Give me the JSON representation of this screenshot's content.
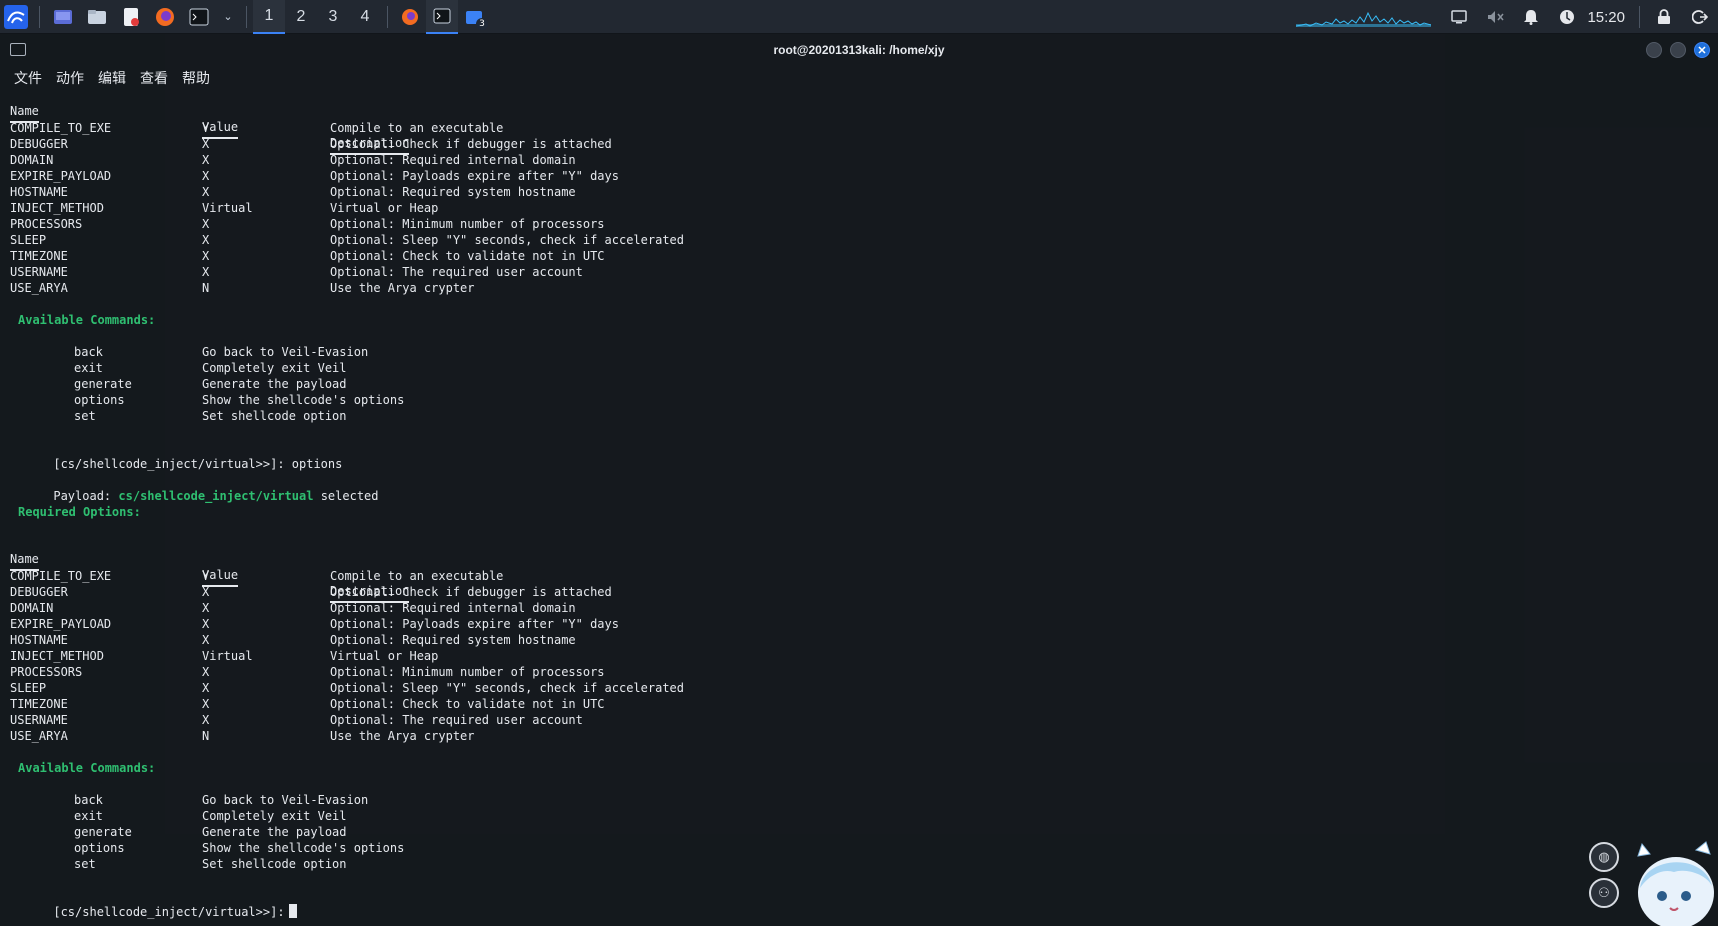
{
  "taskbar": {
    "workspaces": [
      "1",
      "2",
      "3",
      "4"
    ],
    "active_workspace": "1",
    "file_manager_badge": "3",
    "clock": "15:20"
  },
  "window": {
    "title": "root@20201313kali: /home/xjy",
    "menu": [
      "文件",
      "动作",
      "编辑",
      "查看",
      "帮助"
    ]
  },
  "terminal": {
    "header": {
      "name": "Name",
      "value": "Value",
      "description": "Description"
    },
    "options1": [
      {
        "name": "COMPILE_TO_EXE",
        "value": "Y",
        "desc": "Compile to an executable"
      },
      {
        "name": "DEBUGGER",
        "value": "X",
        "desc": "Optional: Check if debugger is attached"
      },
      {
        "name": "DOMAIN",
        "value": "X",
        "desc": "Optional: Required internal domain"
      },
      {
        "name": "EXPIRE_PAYLOAD",
        "value": "X",
        "desc": "Optional: Payloads expire after \"Y\" days"
      },
      {
        "name": "HOSTNAME",
        "value": "X",
        "desc": "Optional: Required system hostname"
      },
      {
        "name": "INJECT_METHOD",
        "value": "Virtual",
        "desc": "Virtual or Heap"
      },
      {
        "name": "PROCESSORS",
        "value": "X",
        "desc": "Optional: Minimum number of processors"
      },
      {
        "name": "SLEEP",
        "value": "X",
        "desc": "Optional: Sleep \"Y\" seconds, check if accelerated"
      },
      {
        "name": "TIMEZONE",
        "value": "X",
        "desc": "Optional: Check to validate not in UTC"
      },
      {
        "name": "USERNAME",
        "value": "X",
        "desc": "Optional: The required user account"
      },
      {
        "name": "USE_ARYA",
        "value": "N",
        "desc": "Use the Arya crypter"
      }
    ],
    "available_commands_label": "Available Commands:",
    "commands": [
      {
        "cmd": "back",
        "desc": "Go back to Veil-Evasion"
      },
      {
        "cmd": "exit",
        "desc": "Completely exit Veil"
      },
      {
        "cmd": "generate",
        "desc": "Generate the payload"
      },
      {
        "cmd": "options",
        "desc": "Show the shellcode's options"
      },
      {
        "cmd": "set",
        "desc": "Set shellcode option"
      }
    ],
    "prompt": "[cs/shellcode_inject/virtual>>]:",
    "entered_command": "options",
    "payload_prefix": "Payload:",
    "payload_name": "cs/shellcode_inject/virtual",
    "payload_suffix": "selected",
    "required_options_label": "Required Options:"
  }
}
